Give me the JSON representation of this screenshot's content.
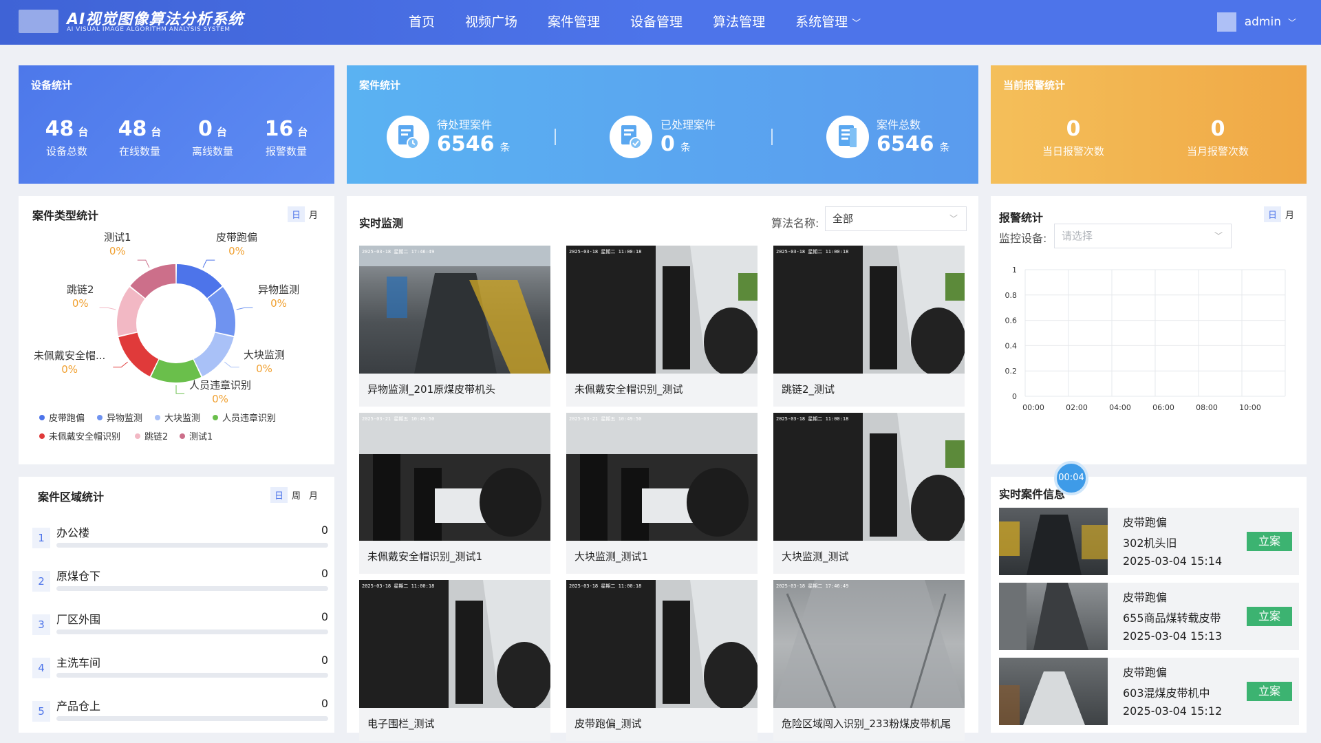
{
  "header": {
    "title": "AI视觉图像算法分析系统",
    "subtitle": "AI VISUAL IMAGE ALGORITHM ANALYSIS SYSTEM",
    "nav": [
      "首页",
      "视频广场",
      "案件管理",
      "设备管理",
      "算法管理",
      "系统管理"
    ],
    "user": "admin"
  },
  "device_stats": {
    "title": "设备统计",
    "unit": "台",
    "items": [
      {
        "value": "48",
        "label": "设备总数"
      },
      {
        "value": "48",
        "label": "在线数量"
      },
      {
        "value": "0",
        "label": "离线数量"
      },
      {
        "value": "16",
        "label": "报警数量"
      }
    ]
  },
  "case_stats": {
    "title": "案件统计",
    "unit": "条",
    "items": [
      {
        "label": "待处理案件",
        "value": "6546"
      },
      {
        "label": "已处理案件",
        "value": "0"
      },
      {
        "label": "案件总数",
        "value": "6546"
      }
    ]
  },
  "alarm_current": {
    "title": "当前报警统计",
    "items": [
      {
        "value": "0",
        "label": "当日报警次数"
      },
      {
        "value": "0",
        "label": "当月报警次数"
      }
    ]
  },
  "case_type": {
    "title": "案件类型统计",
    "toggle": [
      "日",
      "月"
    ],
    "chart_data": {
      "type": "pie",
      "series": [
        {
          "name": "皮带跑偏",
          "value": 0,
          "percent": "0%",
          "color": "#4d74ea"
        },
        {
          "name": "异物监测",
          "value": 0,
          "percent": "0%",
          "color": "#6f93f0"
        },
        {
          "name": "大块监测",
          "value": 0,
          "percent": "0%",
          "color": "#a9c1f7"
        },
        {
          "name": "人员违章识别",
          "value": 0,
          "percent": "0%",
          "color": "#6abf4b"
        },
        {
          "name": "未佩戴安全帽识别",
          "value": 0,
          "percent": "0%",
          "color": "#e03a3a"
        },
        {
          "name": "跳链2",
          "value": 0,
          "percent": "0%",
          "color": "#f2b8c4"
        },
        {
          "name": "测试1",
          "value": 0,
          "percent": "0%",
          "color": "#cc6f8a"
        }
      ]
    },
    "outer_labels": [
      "皮带跑偏",
      "异物监测",
      "大块监测",
      "人员违章识别",
      "未佩戴安全帽...",
      "跳链2",
      "测试1"
    ]
  },
  "area_stats": {
    "title": "案件区域统计",
    "toggle": [
      "日",
      "周",
      "月"
    ],
    "rows": [
      {
        "idx": "1",
        "name": "办公楼",
        "value": "0"
      },
      {
        "idx": "2",
        "name": "原煤仓下",
        "value": "0"
      },
      {
        "idx": "3",
        "name": "厂区外围",
        "value": "0"
      },
      {
        "idx": "4",
        "name": "主洗车间",
        "value": "0"
      },
      {
        "idx": "5",
        "name": "产品仓上",
        "value": "0"
      }
    ]
  },
  "monitor": {
    "title": "实时监测",
    "algo_label": "算法名称:",
    "algo_value": "全部",
    "cams": [
      {
        "caption": "异物监测_201原煤皮带机头",
        "ts": "2025-03-18 星期二 17:46:49"
      },
      {
        "caption": "未佩戴安全帽识别_测试",
        "ts": "2025-03-18 星期二 11:00:18"
      },
      {
        "caption": "跳链2_测试",
        "ts": "2025-03-18 星期二 11:00:18"
      },
      {
        "caption": "未佩戴安全帽识别_测试1",
        "ts": "2025-03-21 星期五 10:49:50"
      },
      {
        "caption": "大块监测_测试1",
        "ts": "2025-03-21 星期五 10:49:50"
      },
      {
        "caption": "大块监测_测试",
        "ts": "2025-03-18 星期二 11:00:18"
      },
      {
        "caption": "电子围栏_测试",
        "ts": "2025-03-18 星期二 11:00:18"
      },
      {
        "caption": "皮带跑偏_测试",
        "ts": "2025-03-18 星期二 11:00:18"
      },
      {
        "caption": "危险区域闯入识别_233粉煤皮带机尾",
        "ts": "2025-03-18 星期二 17:46:49"
      }
    ]
  },
  "alarm_stats": {
    "title": "报警统计",
    "toggle": [
      "日",
      "月"
    ],
    "device_label": "监控设备:",
    "device_placeholder": "请选择",
    "chart_data": {
      "type": "line",
      "x": [
        "00:00",
        "02:00",
        "04:00",
        "06:00",
        "08:00",
        "10:00"
      ],
      "series": [],
      "ylim": [
        0,
        1
      ],
      "yticks": [
        "1",
        "0.8",
        "0.6",
        "0.4",
        "0.2",
        "0"
      ],
      "grid": true
    }
  },
  "realtime_cases": {
    "title": "实时案件信息",
    "timer": "00:04",
    "items": [
      {
        "type": "皮带跑偏",
        "place": "302机头旧",
        "time": "2025-03-04 15:14",
        "action": "立案"
      },
      {
        "type": "皮带跑偏",
        "place": "655商品煤转载皮带",
        "time": "2025-03-04 15:13",
        "action": "立案"
      },
      {
        "type": "皮带跑偏",
        "place": "603混煤皮带机中",
        "time": "2025-03-04 15:12",
        "action": "立案"
      }
    ]
  },
  "colors": {
    "brand": "#4d74ea",
    "device_card": "#4f79ea",
    "case_card": "#5aaaf0",
    "alarm_card": "#f2b04a",
    "accent_green": "#3cb371"
  }
}
